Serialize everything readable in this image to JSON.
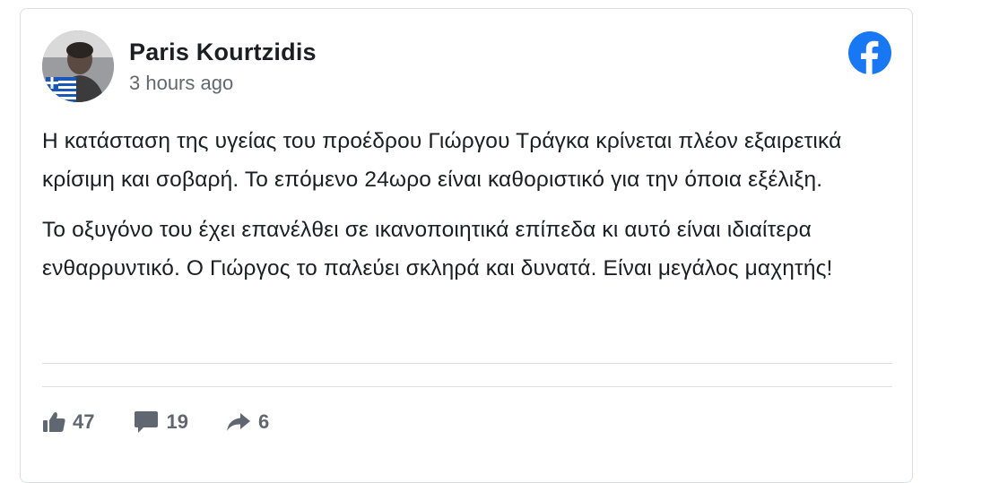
{
  "post": {
    "author": "Paris Kourtzidis",
    "timestamp": "3 hours ago",
    "paragraphs": [
      "Η κατάσταση της υγείας του προέδρου Γιώργου Τράγκα κρίνεται πλέον εξαιρετικά κρίσιμη και σοβαρή. Το επόμενο 24ωρο είναι καθοριστικό για την όποια εξέλιξη.",
      "Το οξυγόνο του έχει επανέλθει σε ικανοποιητικά επίπεδα κι αυτό είναι ιδιαίτερα ενθαρρυντικό. Ο Γιώργος το παλεύει σκληρά και δυνατά. Είναι μεγάλος μαχητής!"
    ],
    "platform_icon": "facebook-logo-icon",
    "brand_color": "#1877f2"
  },
  "actions": {
    "likes": "47",
    "comments": "19",
    "shares": "6",
    "like_icon": "thumbs-up-icon",
    "comment_icon": "comment-bubble-icon",
    "share_icon": "share-arrow-icon",
    "icon_color": "#606770"
  }
}
